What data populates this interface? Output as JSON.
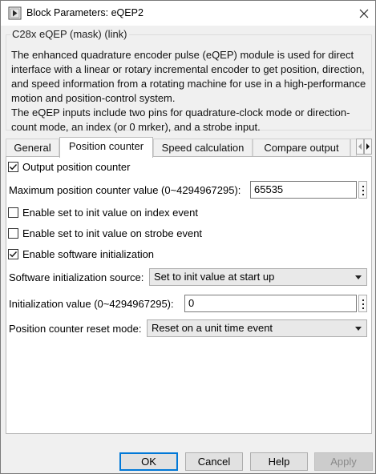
{
  "window": {
    "title": "Block Parameters: eQEP2"
  },
  "description": {
    "group_title": "C28x eQEP (mask) (link)",
    "paragraphs": [
      "The enhanced quadrature encoder pulse (eQEP) module is used for direct interface with a linear or rotary incremental encoder to get position, direction, and speed information from a rotating machine for use in a high-performance motion and position-control system.",
      "The eQEP inputs include two pins for quadrature-clock mode or direction-count mode, an index (or 0 mrker), and a strobe input."
    ]
  },
  "tabs": [
    {
      "label": "General",
      "active": false
    },
    {
      "label": "Position counter",
      "active": true
    },
    {
      "label": "Speed calculation",
      "active": false
    },
    {
      "label": "Compare output",
      "active": false
    }
  ],
  "params": {
    "output_position_counter": {
      "label": "Output position counter",
      "checked": true
    },
    "max_position_counter": {
      "label": "Maximum position counter value (0~4294967295):",
      "value": "65535"
    },
    "init_on_index": {
      "label": "Enable set to init value on index event",
      "checked": false
    },
    "init_on_strobe": {
      "label": "Enable set to init value on strobe event",
      "checked": false
    },
    "software_init": {
      "label": "Enable software initialization",
      "checked": true
    },
    "software_init_source": {
      "label": "Software initialization source:",
      "value": "Set to init value at start up"
    },
    "init_value": {
      "label": "Initialization value (0~4294967295):",
      "value": "0"
    },
    "reset_mode": {
      "label": "Position counter reset mode:",
      "value": "Reset on a unit time event"
    }
  },
  "buttons": {
    "ok": "OK",
    "cancel": "Cancel",
    "help": "Help",
    "apply": "Apply"
  },
  "icons": {
    "app": "block-parameters-icon",
    "close": "close-icon",
    "tab_left": "chevron-left-icon",
    "tab_right": "chevron-right-icon",
    "kebab": "more-options-icon",
    "dropdown": "chevron-down-icon"
  },
  "colors": {
    "default_button_border": "#0078d7",
    "panel_background": "#ffffff",
    "window_background": "#f0f0f0"
  }
}
